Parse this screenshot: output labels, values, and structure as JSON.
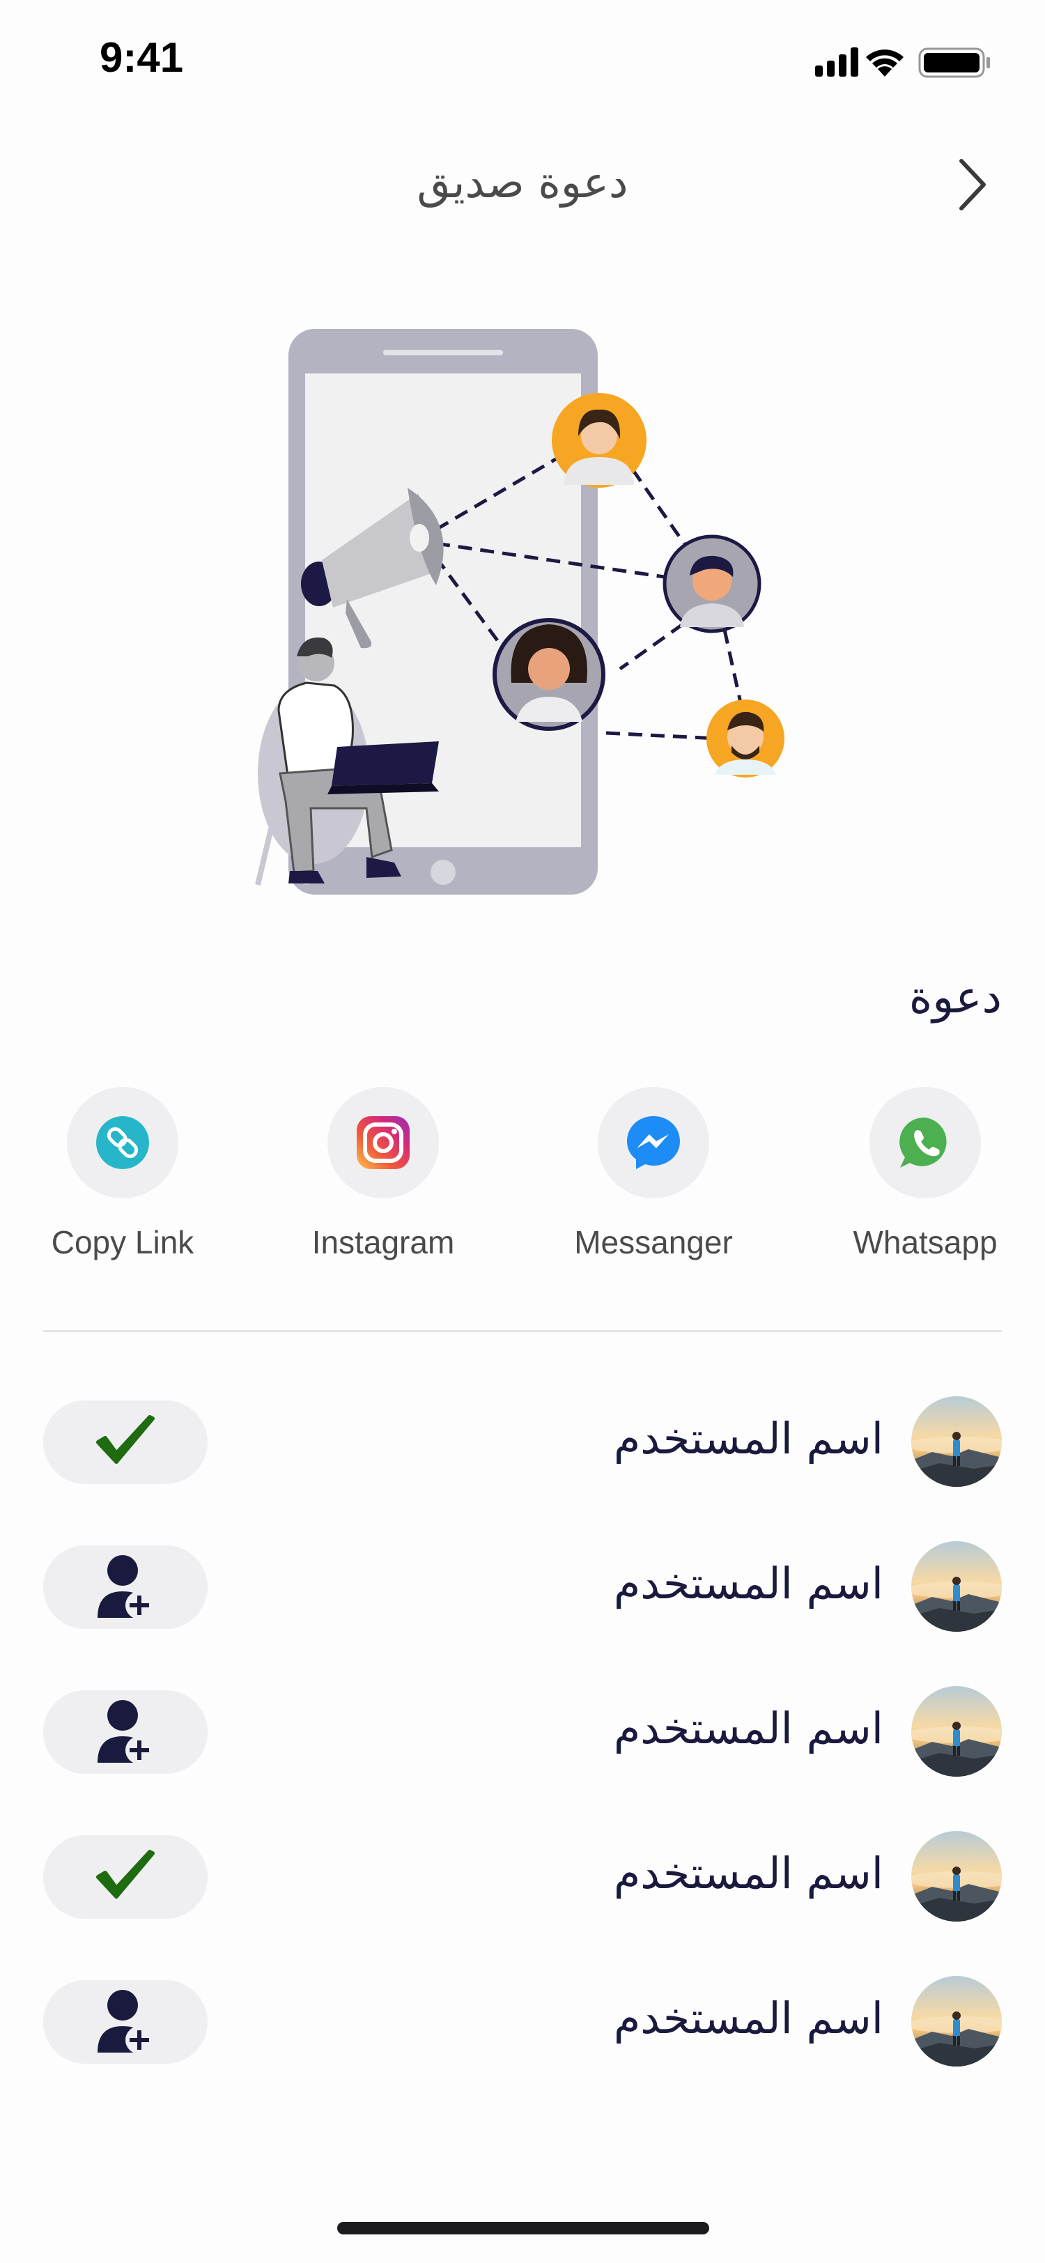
{
  "status_bar": {
    "time": "9:41"
  },
  "header": {
    "title": "دعوة صديق"
  },
  "section": {
    "title": "دعوة"
  },
  "share": [
    {
      "label": "Whatsapp",
      "icon": "whatsapp-icon"
    },
    {
      "label": "Messanger",
      "icon": "messenger-icon"
    },
    {
      "label": "Instagram",
      "icon": "instagram-icon"
    },
    {
      "label": "Copy Link",
      "icon": "link-icon"
    }
  ],
  "users": [
    {
      "name": "اسم المستخدم",
      "status": "invited",
      "icon": "check-icon"
    },
    {
      "name": "اسم المستخدم",
      "status": "add",
      "icon": "add-user-icon"
    },
    {
      "name": "اسم المستخدم",
      "status": "add",
      "icon": "add-user-icon"
    },
    {
      "name": "اسم المستخدم",
      "status": "invited",
      "icon": "check-icon"
    },
    {
      "name": "اسم المستخدم",
      "status": "add",
      "icon": "add-user-icon"
    }
  ],
  "colors": {
    "accent": "#1a1a3e",
    "check": "#1e6b10",
    "pill_bg": "#efeff1"
  }
}
